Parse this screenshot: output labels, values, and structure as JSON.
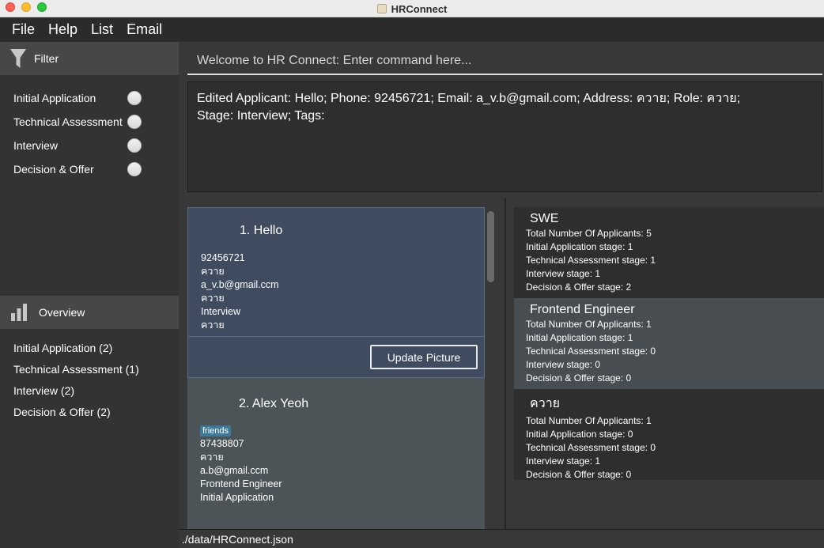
{
  "window": {
    "title": "HRConnect"
  },
  "menu": [
    "File",
    "Help",
    "List",
    "Email"
  ],
  "filter": {
    "header": "Filter",
    "options": [
      "Initial Application",
      "Technical Assessment",
      "Interview",
      "Decision & Offer"
    ]
  },
  "overview": {
    "header": "Overview",
    "items": [
      "Initial Application (2)",
      "Technical Assessment (1)",
      "Interview (2)",
      "Decision & Offer (2)"
    ]
  },
  "command": {
    "placeholder": "Welcome to HR Connect: Enter command here..."
  },
  "result": {
    "line1": "Edited Applicant: Hello; Phone: 92456721; Email: a_v.b@gmail.com; Address: ควาย; Role: ควาย;",
    "line2": "Stage: Interview; Tags:"
  },
  "applicants": [
    {
      "title": "1.  Hello",
      "phone": "92456721",
      "address": "ควาย",
      "email": "a_v.b@gmail.ccm",
      "role": "ควาย",
      "stage": "Interview",
      "extra": "ควาย",
      "button": "Update Picture"
    },
    {
      "title": "2.  Alex Yeoh",
      "tag": "friends",
      "phone": "87438807",
      "address": "ควาย",
      "email": "a.b@gmail.ccm",
      "role": "Frontend Engineer",
      "stage": "Initial Application"
    }
  ],
  "roles": [
    {
      "name": "SWE",
      "total": "Total Number Of Applicants: 5",
      "initial": "Initial Application stage: 1",
      "technical": "Technical Assessment stage: 1",
      "interview": "Interview stage: 1",
      "decision": "Decision & Offer stage: 2"
    },
    {
      "name": "Frontend Engineer",
      "total": "Total Number Of Applicants: 1",
      "initial": "Initial Application stage: 1",
      "technical": "Technical Assessment stage: 0",
      "interview": "Interview stage: 0",
      "decision": "Decision & Offer stage: 0"
    },
    {
      "name": "ควาย",
      "total": "Total Number Of Applicants: 1",
      "initial": "Initial Application stage: 0",
      "technical": "Technical Assessment stage: 0",
      "interview": "Interview stage: 1",
      "decision": "Decision & Offer stage: 0"
    }
  ],
  "status": {
    "path": "./data/HRConnect.json"
  },
  "icons": {
    "filter": "filter-funnel-icon",
    "overview": "bar-chart-icon"
  },
  "colors": {
    "selected_card": "#3f4c5f",
    "tag": "#3d7a99"
  }
}
